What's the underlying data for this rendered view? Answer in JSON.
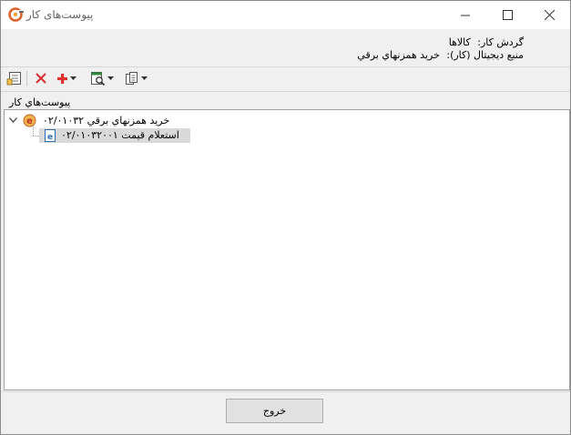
{
  "window": {
    "title": "پیوست‌های کار"
  },
  "info": {
    "workflow_label": "گردش کار:",
    "workflow_value": "کالاها",
    "source_label": "منبع دیجیتال (کار):",
    "source_value": "خرید همزنهاي برقي"
  },
  "toolbar": {
    "icons": [
      "attach-list-icon",
      "delete-icon",
      "add-icon",
      "preview-icon",
      "copy-icon"
    ]
  },
  "group": {
    "label": "پیوست‌هاي کار"
  },
  "tree": {
    "root": {
      "text": "خرید همزنهاي برقي  ۰۲/۰۱۰۳۲"
    },
    "child": {
      "text": "استعلام قیمت  ۰۲/۰۱۰۳۲۰۰۱"
    }
  },
  "footer": {
    "exit_label": "خروج"
  },
  "colors": {
    "add": "#e03030",
    "delete": "#d83030",
    "selection": "#d9d9d9",
    "app_icon": "#d9622a"
  }
}
